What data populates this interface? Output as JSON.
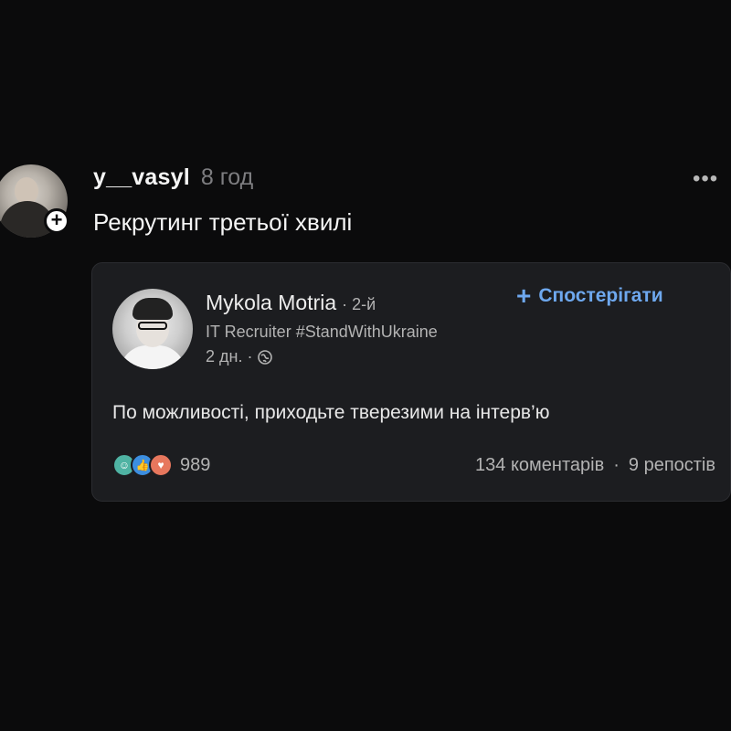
{
  "post": {
    "username": "y__vasyl",
    "timestamp": "8 год",
    "text": "Рекрутинг третьої хвилі",
    "more_icon": "more-horizontal-icon",
    "follow_icon": "plus-icon"
  },
  "embed": {
    "author_name": "Mykola Motria",
    "degree": "· 2-й",
    "headline": "IT Recruiter #StandWithUkraine",
    "time": "2 дн. ·",
    "visibility_icon": "globe-icon",
    "follow_label": "Спостерігати",
    "text": "По можливості, приходьте тверезими на інтерв’ю",
    "reactions": [
      "celebrate-icon",
      "like-icon",
      "love-icon"
    ],
    "reaction_count": "989",
    "comments": "134 коментарів",
    "separator": "·",
    "reposts": "9 репостів"
  },
  "colors": {
    "background": "#0b0b0c",
    "card": "#1c1d20",
    "accent": "#6ea8ee",
    "secondary_text": "#b3b3b3"
  }
}
